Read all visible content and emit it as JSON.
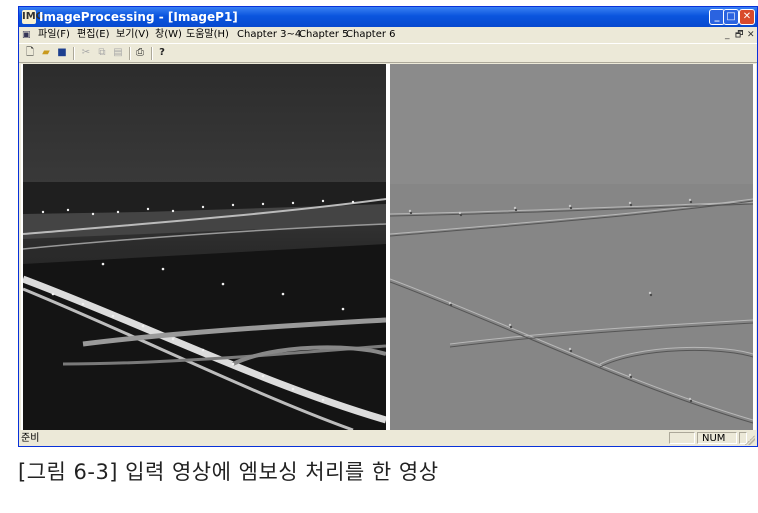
{
  "window": {
    "title": "ImageProcessing - [ImageP1]",
    "app_icon": "image-app-icon"
  },
  "title_buttons": {
    "minimize": "_",
    "maximize": "□",
    "close": "✕"
  },
  "menu": {
    "items": [
      "파일(F)",
      "편집(E)",
      "보기(V)",
      "창(W)",
      "도움말(H)",
      "Chapter 3~4",
      "Chapter 5",
      "Chapter 6"
    ],
    "mdi_controls": [
      "_",
      "🗗",
      "✕"
    ]
  },
  "toolbar": {
    "icons": [
      "new-file-icon",
      "open-folder-icon",
      "save-disk-icon",
      "cut-icon",
      "copy-icon",
      "paste-icon",
      "print-icon",
      "help-icon"
    ]
  },
  "images": {
    "left": "input-night-city-image",
    "right": "embossed-output-image"
  },
  "statusbar": {
    "text": "준비",
    "num": "NUM"
  },
  "caption": "[그림 6-3] 입력 영상에 엠보싱 처리를 한 영상",
  "colors": {
    "title_active": "#0a55de",
    "close_button": "#d94a2c",
    "window_face": "#ece9d8"
  }
}
